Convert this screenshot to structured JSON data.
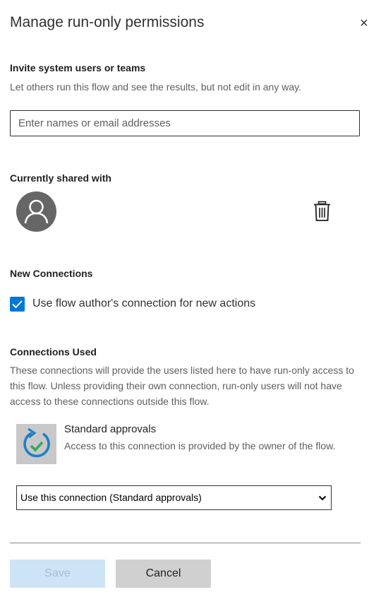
{
  "panel": {
    "title": "Manage run-only permissions",
    "close_glyph": "×"
  },
  "invite": {
    "heading": "Invite system users or teams",
    "description": "Let others run this flow and see the results, but not edit in any way.",
    "placeholder": "Enter names or email addresses",
    "value": ""
  },
  "shared": {
    "heading": "Currently shared with",
    "avatar_icon": "person-icon",
    "delete_icon": "trash-icon"
  },
  "new_connections": {
    "heading": "New Connections",
    "checkbox_checked": true,
    "checkbox_label": "Use flow author's connection for new actions",
    "accent_color": "#0078d4"
  },
  "connections_used": {
    "heading": "Connections Used",
    "description": "These connections will provide the users listed here to have run-only access to this flow. Unless providing their own connection, run-only users will not have access to these connections outside this flow.",
    "items": [
      {
        "icon": "approvals-icon",
        "name": "Standard approvals",
        "description": "Access to this connection is provided by the owner of the flow.",
        "selected_option": "Use this connection (Standard approvals)"
      }
    ]
  },
  "footer": {
    "save_label": "Save",
    "cancel_label": "Cancel",
    "save_enabled": false
  }
}
